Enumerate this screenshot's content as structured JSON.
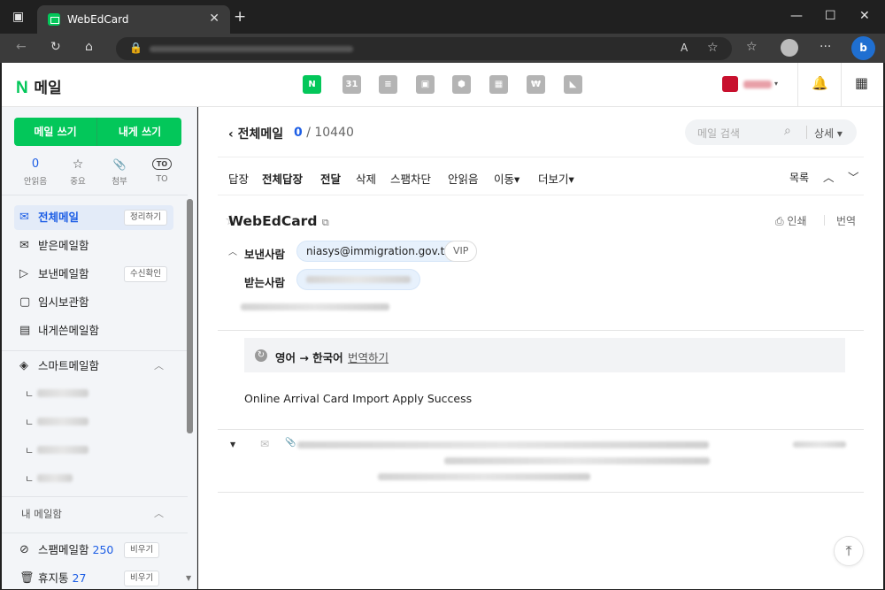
{
  "browser": {
    "tab_title": "WebEdCard",
    "tab_close": "✕",
    "new_tab": "+",
    "window_controls": [
      "—",
      "☐",
      "✕"
    ]
  },
  "app": {
    "logo_n": "N",
    "logo_text": "메일",
    "apps": [
      {
        "name": "mail-app-icon",
        "glyph": "N"
      },
      {
        "name": "calendar-app-icon",
        "glyph": "31"
      },
      {
        "name": "memo-app-icon",
        "glyph": "≡"
      },
      {
        "name": "contacts-app-icon",
        "glyph": "▣"
      },
      {
        "name": "drive-app-icon",
        "glyph": "⬢"
      },
      {
        "name": "qr-app-icon",
        "glyph": "▦"
      },
      {
        "name": "pay-app-icon",
        "glyph": "₩"
      },
      {
        "name": "bookmark-app-icon",
        "glyph": "◣"
      }
    ]
  },
  "sidebar": {
    "write_mail": "메일 쓰기",
    "write_self": "내게 쓰기",
    "quick": [
      {
        "value": "0",
        "label": "안읽음"
      },
      {
        "value": "☆",
        "label": "중요"
      },
      {
        "value": "📎",
        "label": "첨부"
      },
      {
        "value": "TO",
        "label": "TO"
      }
    ],
    "nav": [
      {
        "icon": "✉",
        "label": "전체메일",
        "chip": "정리하기"
      },
      {
        "icon": "✉",
        "label": "받은메일함",
        "chip": ""
      },
      {
        "icon": "▷",
        "label": "보낸메일함",
        "chip": "수신확인"
      },
      {
        "icon": "▢",
        "label": "임시보관함",
        "chip": ""
      },
      {
        "icon": "▤",
        "label": "내게쓴메일함",
        "chip": ""
      }
    ],
    "smart": {
      "icon": "◈",
      "label": "스마트메일함",
      "chevron": "︿"
    },
    "smart_sub_marker": "ㄴ",
    "my_mailbox": {
      "label": "내 메일함",
      "chevron": "︿"
    },
    "spam": {
      "icon": "⊘",
      "label": "스팸메일함",
      "count": "250",
      "chip": "비우기"
    },
    "trash": {
      "icon": "🗑",
      "label": "휴지통",
      "count": "27",
      "chip": "비우기"
    },
    "scroll_down": "▼"
  },
  "content": {
    "folder": "전체메일",
    "unread": "0",
    "total": "/ 10440",
    "search_placeholder": "메일 검색",
    "detail": "상세",
    "toolbar": [
      "답장",
      "전체답장",
      "전달",
      "삭제",
      "스팸차단",
      "안읽음",
      "이동▾",
      "더보기▾"
    ],
    "list_label": "목록",
    "mail_title": "WebEdCard",
    "print": "인쇄",
    "translate": "번역",
    "sender_label": "보낸사람",
    "sender_email": "niasys@immigration.gov.tw",
    "vip": "VIP",
    "receiver_label": "받는사람",
    "translation_lang": "영어 → 한국어",
    "translation_link": "번역하기",
    "body_text": "Online Arrival Card Import Apply Success"
  }
}
